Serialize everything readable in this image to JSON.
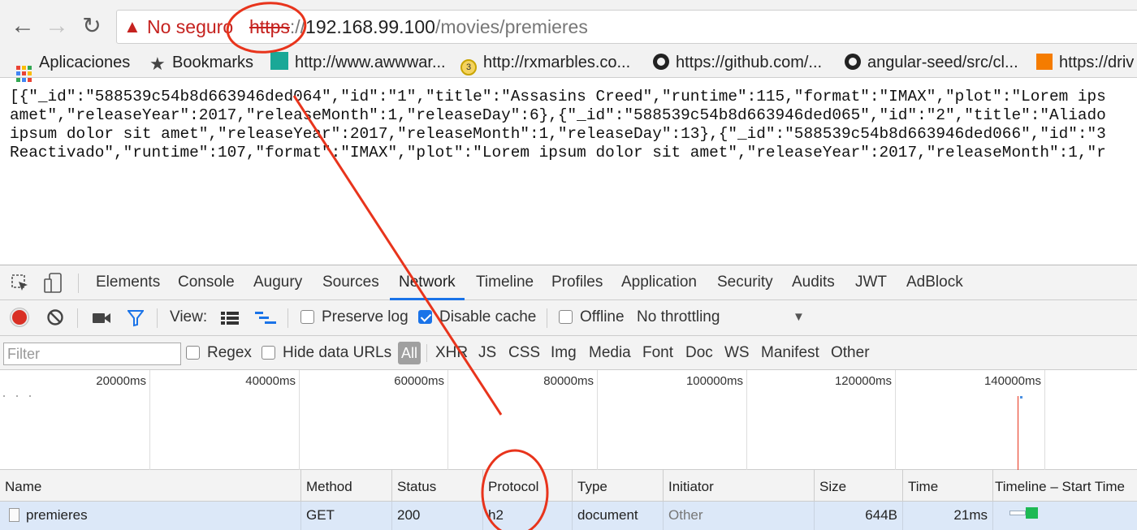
{
  "omnibox": {
    "security_label": "No seguro",
    "scheme": "https",
    "separator": "://",
    "host": "192.168.99.100",
    "path": "/movies/premieres"
  },
  "bookmarks": [
    {
      "label": "Aplicaciones",
      "icon": "apps-grid-icon"
    },
    {
      "label": "Bookmarks",
      "icon": "star-icon"
    },
    {
      "label": "http://www.awwwar...",
      "icon": "awwwards-icon"
    },
    {
      "label": "http://rxmarbles.co...",
      "icon": "rxmarbles-icon"
    },
    {
      "label": "https://github.com/...",
      "icon": "github-icon"
    },
    {
      "label": "angular-seed/src/cl...",
      "icon": "github-icon"
    },
    {
      "label": "https://driv",
      "icon": "drive-icon"
    }
  ],
  "page_json_lines": [
    "[{\"_id\":\"588539c54b8d663946ded064\",\"id\":\"1\",\"title\":\"Assasins Creed\",\"runtime\":115,\"format\":\"IMAX\",\"plot\":\"Lorem ips",
    "amet\",\"releaseYear\":2017,\"releaseMonth\":1,\"releaseDay\":6},{\"_id\":\"588539c54b8d663946ded065\",\"id\":\"2\",\"title\":\"Aliado",
    "ipsum dolor sit amet\",\"releaseYear\":2017,\"releaseMonth\":1,\"releaseDay\":13},{\"_id\":\"588539c54b8d663946ded066\",\"id\":\"3",
    "Reactivado\",\"runtime\":107,\"format\":\"IMAX\",\"plot\":\"Lorem ipsum dolor sit amet\",\"releaseYear\":2017,\"releaseMonth\":1,\"r"
  ],
  "devtools": {
    "tabs": [
      "Elements",
      "Console",
      "Augury",
      "Sources",
      "Network",
      "Timeline",
      "Profiles",
      "Application",
      "Security",
      "Audits",
      "JWT",
      "AdBlock"
    ],
    "active_tab": "Network",
    "toolbar": {
      "view_label": "View:",
      "preserve_log": "Preserve log",
      "disable_cache": "Disable cache",
      "offline": "Offline",
      "throttling": "No throttling",
      "preserve_log_checked": false,
      "disable_cache_checked": true,
      "offline_checked": false
    },
    "filter": {
      "placeholder": "Filter",
      "regex": "Regex",
      "hide_data_urls": "Hide data URLs",
      "types": [
        "All",
        "XHR",
        "JS",
        "CSS",
        "Img",
        "Media",
        "Font",
        "Doc",
        "WS",
        "Manifest",
        "Other"
      ]
    },
    "overview_ticks": [
      "20000ms",
      "40000ms",
      "60000ms",
      "80000ms",
      "100000ms",
      "120000ms",
      "140000ms"
    ],
    "columns": [
      "Name",
      "Method",
      "Status",
      "Protocol",
      "Type",
      "Initiator",
      "Size",
      "Time",
      "Timeline – Start Time"
    ],
    "rows": [
      {
        "name": "premieres",
        "method": "GET",
        "status": "200",
        "protocol": "h2",
        "type": "document",
        "initiator": "Other",
        "size": "644B",
        "time": "21ms"
      }
    ]
  },
  "colors": {
    "annotation_red": "#e8341c",
    "record_red": "#d93025",
    "accent_blue": "#1a73e8"
  }
}
